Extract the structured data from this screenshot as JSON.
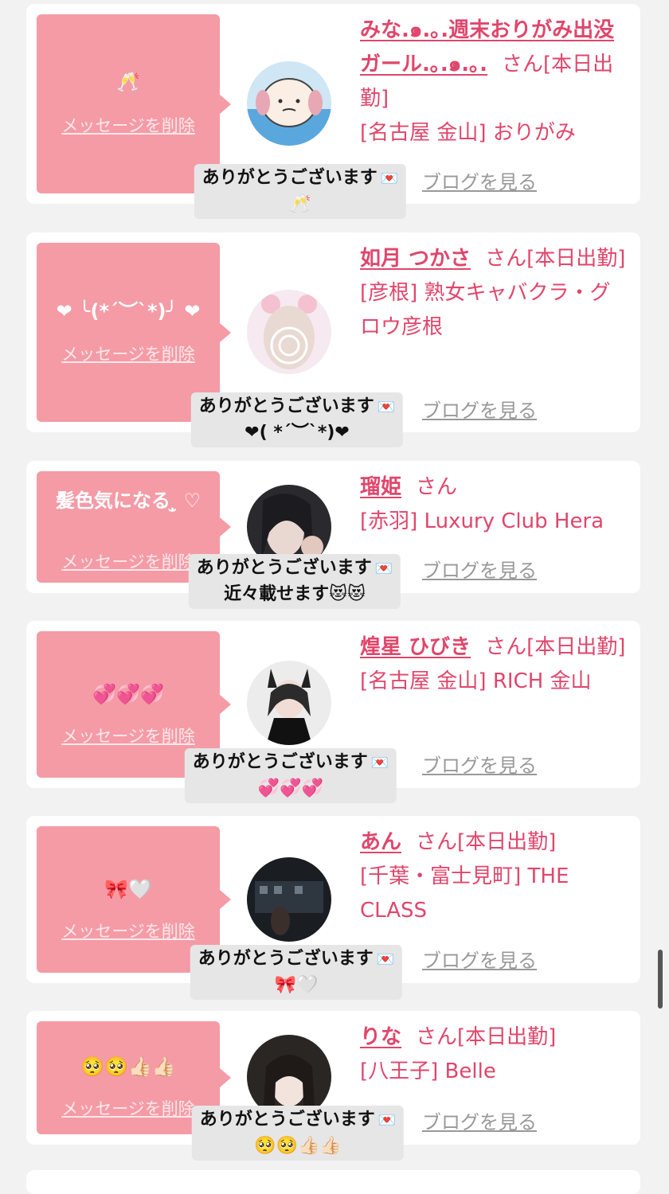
{
  "toast_label": "ありがとうございます",
  "delete_label": "メッセージを削除",
  "blog_label": "ブログを見る",
  "honorific": "さん",
  "cards": [
    {
      "message": "🥂",
      "name": "みな.๑.｡.週末おりがみ出没ガール.｡.๑.｡.",
      "status": "[本日出勤]",
      "shop": "[名古屋 金山] おりがみ",
      "reaction": "🥂"
    },
    {
      "message": "❤︎ ╰(*´︶`*)╯ ❤︎",
      "name": "如月 つかさ",
      "status": "[本日出勤]",
      "shop": "[彦根] 熟女キャバクラ・グロウ彦根",
      "reaction": "❤︎( *´︶`*)❤︎"
    },
    {
      "message": "髪色気になる ̹̫̹ ♡",
      "name": "瑠姫",
      "status": "",
      "shop": "[赤羽] Luxury Club Hera",
      "reaction": "近々載せます😻😻"
    },
    {
      "message": "💞💞💞",
      "name": "煌星 ひびき",
      "status": "[本日出勤]",
      "shop": "[名古屋 金山] RICH 金山",
      "reaction": "💞💞💞"
    },
    {
      "message": "🎀🤍",
      "name": "あん",
      "status": "[本日出勤]",
      "shop": "[千葉・富士見町] THE CLASS",
      "reaction": "🎀🤍"
    },
    {
      "message": "🥺🥺👍🏻👍🏻",
      "name": "りな",
      "status": "[本日出勤]",
      "shop": "[八王子] Belle",
      "reaction": "🥺🥺👍🏻👍🏻"
    }
  ]
}
